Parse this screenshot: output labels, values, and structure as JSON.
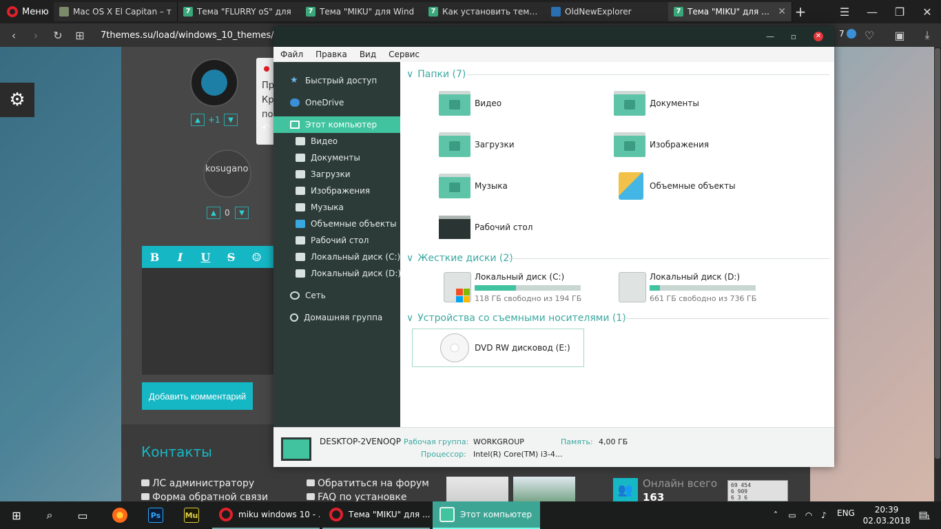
{
  "browser": {
    "menu_label": "Меню",
    "tabs": [
      {
        "title": "Mac OS X El Capitan – т"
      },
      {
        "title": "Тема \"FLURRY oS\" для"
      },
      {
        "title": "Тема \"MIKU\" для Wind"
      },
      {
        "title": "Как установить темы д"
      },
      {
        "title": "OldNewExplorer"
      },
      {
        "title": "Тема \"MIKU\" для Wind"
      }
    ],
    "new_tab": "+",
    "url": "7themes.su/load/windows_10_themes/f",
    "ext_badge": "7"
  },
  "page": {
    "score_1": "+1",
    "score_2": "0",
    "avatar_alt": "kosugano",
    "comment_snippet": [
      "Пр",
      "Кр",
      "по"
    ],
    "editor_buttons": [
      "B",
      "I",
      "U",
      "S",
      "☺"
    ],
    "add_comment": "Добавить комментарий",
    "contacts_title": "Контакты",
    "footer_links": [
      "ЛС администратору",
      "Форма обратной связи",
      "Обратиться на форум",
      "FAQ по установке"
    ],
    "online_label": "Онлайн всего",
    "online_count": "163",
    "counter_lines": [
      "69 454",
      "6 909",
      "6 3 6"
    ]
  },
  "explorer": {
    "menu": [
      "Файл",
      "Правка",
      "Вид",
      "Сервис"
    ],
    "nav": [
      {
        "label": "Быстрый доступ",
        "icon": "star-icon"
      },
      {
        "label": "OneDrive",
        "icon": "cloud-icon"
      },
      {
        "label": "Этот компьютер",
        "icon": "monitor-icon"
      },
      {
        "label": "Видео",
        "icon": "film-icon"
      },
      {
        "label": "Документы",
        "icon": "document-icon"
      },
      {
        "label": "Загрузки",
        "icon": "download-icon"
      },
      {
        "label": "Изображения",
        "icon": "camera-icon"
      },
      {
        "label": "Музыка",
        "icon": "music-icon"
      },
      {
        "label": "Объемные объекты",
        "icon": "cube-icon"
      },
      {
        "label": "Рабочий стол",
        "icon": "desktop-icon"
      },
      {
        "label": "Локальный диск (C:)",
        "icon": "drive-icon"
      },
      {
        "label": "Локальный диск (D:)",
        "icon": "drive-icon"
      },
      {
        "label": "Сеть",
        "icon": "network-icon"
      },
      {
        "label": "Домашняя группа",
        "icon": "homegroup-icon"
      }
    ],
    "groups": {
      "folders": "Папки (7)",
      "drives": "Жесткие диски (2)",
      "removable": "Устройства со съемными носителями (1)"
    },
    "folders": [
      "Видео",
      "Документы",
      "Загрузки",
      "Изображения",
      "Музыка",
      "Объемные объекты",
      "Рабочий стол"
    ],
    "drives": [
      {
        "name": "Локальный диск (C:)",
        "free": "118 ГБ свободно из 194 ГБ",
        "used_fraction": 0.39
      },
      {
        "name": "Локальный диск (D:)",
        "free": "661 ГБ свободно из 736 ГБ",
        "used_fraction": 0.1
      }
    ],
    "dvd": "DVD RW дисковод (E:)",
    "details": {
      "computer": "DESKTOP-2VENOQP",
      "workgroup_label": "Рабочая группа:",
      "workgroup": "WORKGROUP",
      "memory_label": "Память:",
      "memory": "4,00 ГБ",
      "cpu_label": "Процессор:",
      "cpu": "Intel(R) Core(TM) i3-4..."
    },
    "accent": "#41c39f"
  },
  "taskbar": {
    "apps": [
      {
        "label": "miku windows 10 - ..."
      },
      {
        "label": "Тема \"MIKU\" для ..."
      },
      {
        "label": "Этот компьютер"
      }
    ],
    "ps_label": "Ps",
    "mu_label": "Mu",
    "lang": "ENG",
    "time": "20:39",
    "date": "02.03.2018",
    "notif_count": "1"
  }
}
